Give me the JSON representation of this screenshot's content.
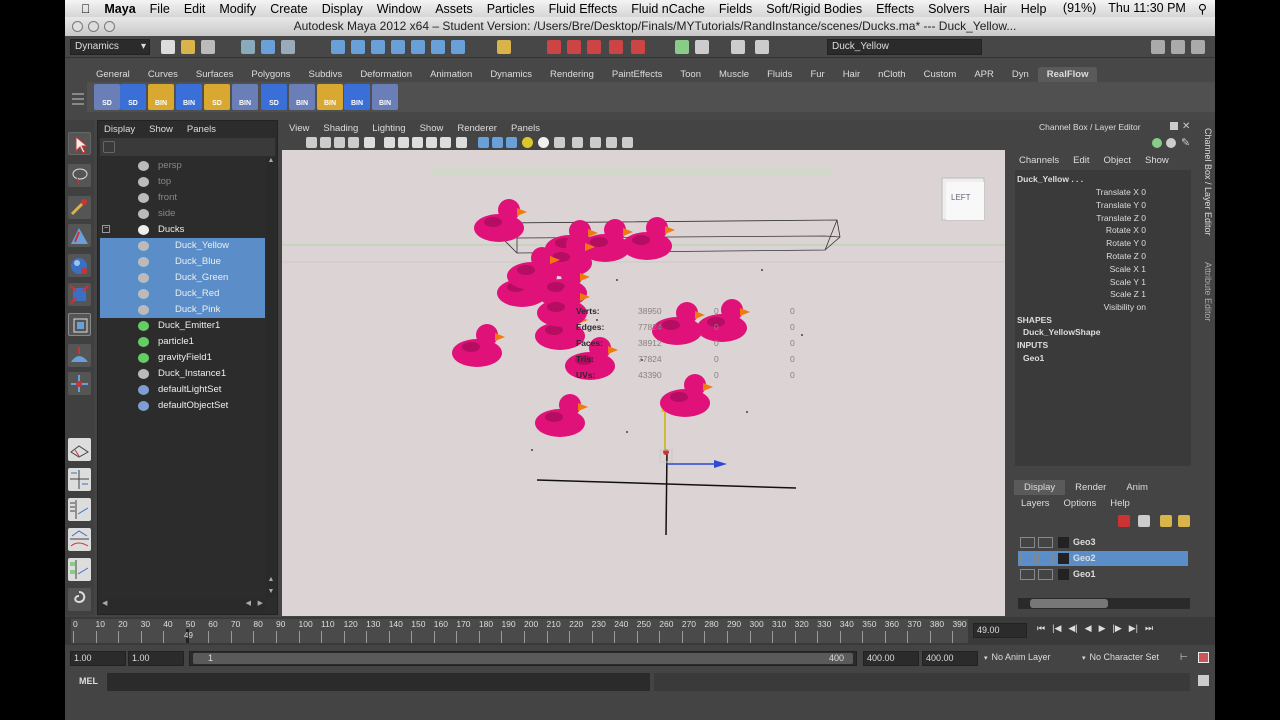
{
  "macbar": {
    "app": "Maya",
    "menus": [
      "File",
      "Edit",
      "Modify",
      "Create",
      "Display",
      "Window",
      "Assets",
      "Particles",
      "Fluid Effects",
      "Fluid nCache",
      "Fields",
      "Soft/Rigid Bodies",
      "Effects",
      "Solvers",
      "Hair",
      "Help"
    ],
    "battery": "(91%)",
    "clock": "Thu 11:30 PM"
  },
  "window_title": "Autodesk Maya 2012 x64 – Student Version: /Users/Bre/Desktop/Finals/MYTutorials/RandInstance/scenes/Ducks.ma*   ---   Duck_Yellow...",
  "statusline": {
    "menuset": "Dynamics",
    "selection_field": "Duck_Yellow"
  },
  "shelf": {
    "tabs": [
      "General",
      "Curves",
      "Surfaces",
      "Polygons",
      "Subdivs",
      "Deformation",
      "Animation",
      "Dynamics",
      "Rendering",
      "PaintEffects",
      "Toon",
      "Muscle",
      "Fluids",
      "Fur",
      "Hair",
      "nCloth",
      "Custom",
      "APR",
      "Dyn",
      "RealFlow"
    ],
    "active_tab": "RealFlow",
    "button_labels": [
      "SD",
      "SD",
      "BIN",
      "BIN",
      "SD",
      "BIN",
      "SD",
      "BIN",
      "BIN",
      "BIN",
      "BIN"
    ]
  },
  "outliner": {
    "menus": [
      "Display",
      "Show",
      "Panels"
    ],
    "items": [
      {
        "label": "persp",
        "dim": true
      },
      {
        "label": "top",
        "dim": true
      },
      {
        "label": "front",
        "dim": true
      },
      {
        "label": "side",
        "dim": true
      },
      {
        "label": "Ducks",
        "group": true
      },
      {
        "label": "Duck_Yellow",
        "selected": true
      },
      {
        "label": "Duck_Blue",
        "selected": true
      },
      {
        "label": "Duck_Green",
        "selected": true
      },
      {
        "label": "Duck_Red",
        "selected": true
      },
      {
        "label": "Duck_Pink",
        "selected": true
      },
      {
        "label": "Duck_Emitter1"
      },
      {
        "label": "particle1"
      },
      {
        "label": "gravityField1"
      },
      {
        "label": "Duck_Instance1"
      },
      {
        "label": "defaultLightSet"
      },
      {
        "label": "defaultObjectSet"
      }
    ]
  },
  "viewport": {
    "menus": [
      "View",
      "Shading",
      "Lighting",
      "Show",
      "Renderer",
      "Panels"
    ],
    "view_cube": "LEFT",
    "hud": [
      {
        "label": "Verts:",
        "values": [
          "38950",
          "0",
          "0"
        ]
      },
      {
        "label": "Edges:",
        "values": [
          "77824",
          "0",
          "0"
        ]
      },
      {
        "label": "Faces:",
        "values": [
          "38912",
          "0",
          "0"
        ]
      },
      {
        "label": "Tris:",
        "values": [
          "77824",
          "0",
          "0"
        ]
      },
      {
        "label": "UVs:",
        "values": [
          "43390",
          "0",
          "0"
        ]
      }
    ]
  },
  "channelbox": {
    "header": "Channel Box / Layer Editor",
    "menus": [
      "Channels",
      "Edit",
      "Object",
      "Show"
    ],
    "object": "Duck_Yellow . . .",
    "attrs": [
      {
        "name": "Translate X",
        "value": "0"
      },
      {
        "name": "Translate Y",
        "value": "0"
      },
      {
        "name": "Translate Z",
        "value": "0"
      },
      {
        "name": "Rotate X",
        "value": "0"
      },
      {
        "name": "Rotate Y",
        "value": "0"
      },
      {
        "name": "Rotate Z",
        "value": "0"
      },
      {
        "name": "Scale X",
        "value": "1"
      },
      {
        "name": "Scale Y",
        "value": "1"
      },
      {
        "name": "Scale Z",
        "value": "1"
      },
      {
        "name": "Visibility",
        "value": "on"
      }
    ],
    "shapes_label": "SHAPES",
    "shape": "Duck_YellowShape",
    "inputs_label": "INPUTS",
    "input": "Geo1",
    "side_tabs": [
      "Channel Box / Layer Editor",
      "Attribute Editor"
    ]
  },
  "layereditor": {
    "tabs": [
      "Display",
      "Render",
      "Anim"
    ],
    "menus": [
      "Layers",
      "Options",
      "Help"
    ],
    "layers": [
      "Geo3",
      "Geo2",
      "Geo1"
    ],
    "selected_layer": "Geo2"
  },
  "timeslider": {
    "ticks": [
      "0",
      "10",
      "20",
      "30",
      "40",
      "50",
      "60",
      "70",
      "80",
      "90",
      "100",
      "110",
      "120",
      "130",
      "140",
      "150",
      "160",
      "170",
      "180",
      "190",
      "200",
      "210",
      "220",
      "230",
      "240",
      "250",
      "260",
      "270",
      "280",
      "290",
      "300",
      "310",
      "320",
      "330",
      "340",
      "350",
      "360",
      "370",
      "380",
      "390"
    ],
    "current_frame": "49.00",
    "cursor_label": "49"
  },
  "range": {
    "start": "1.00",
    "playback_start": "1.00",
    "slider_start": "1",
    "slider_end": "400",
    "playback_end": "400.00",
    "end": "400.00",
    "anim_layer": "No Anim Layer",
    "char_set": "No Character Set"
  },
  "cmd": {
    "label": "MEL"
  }
}
